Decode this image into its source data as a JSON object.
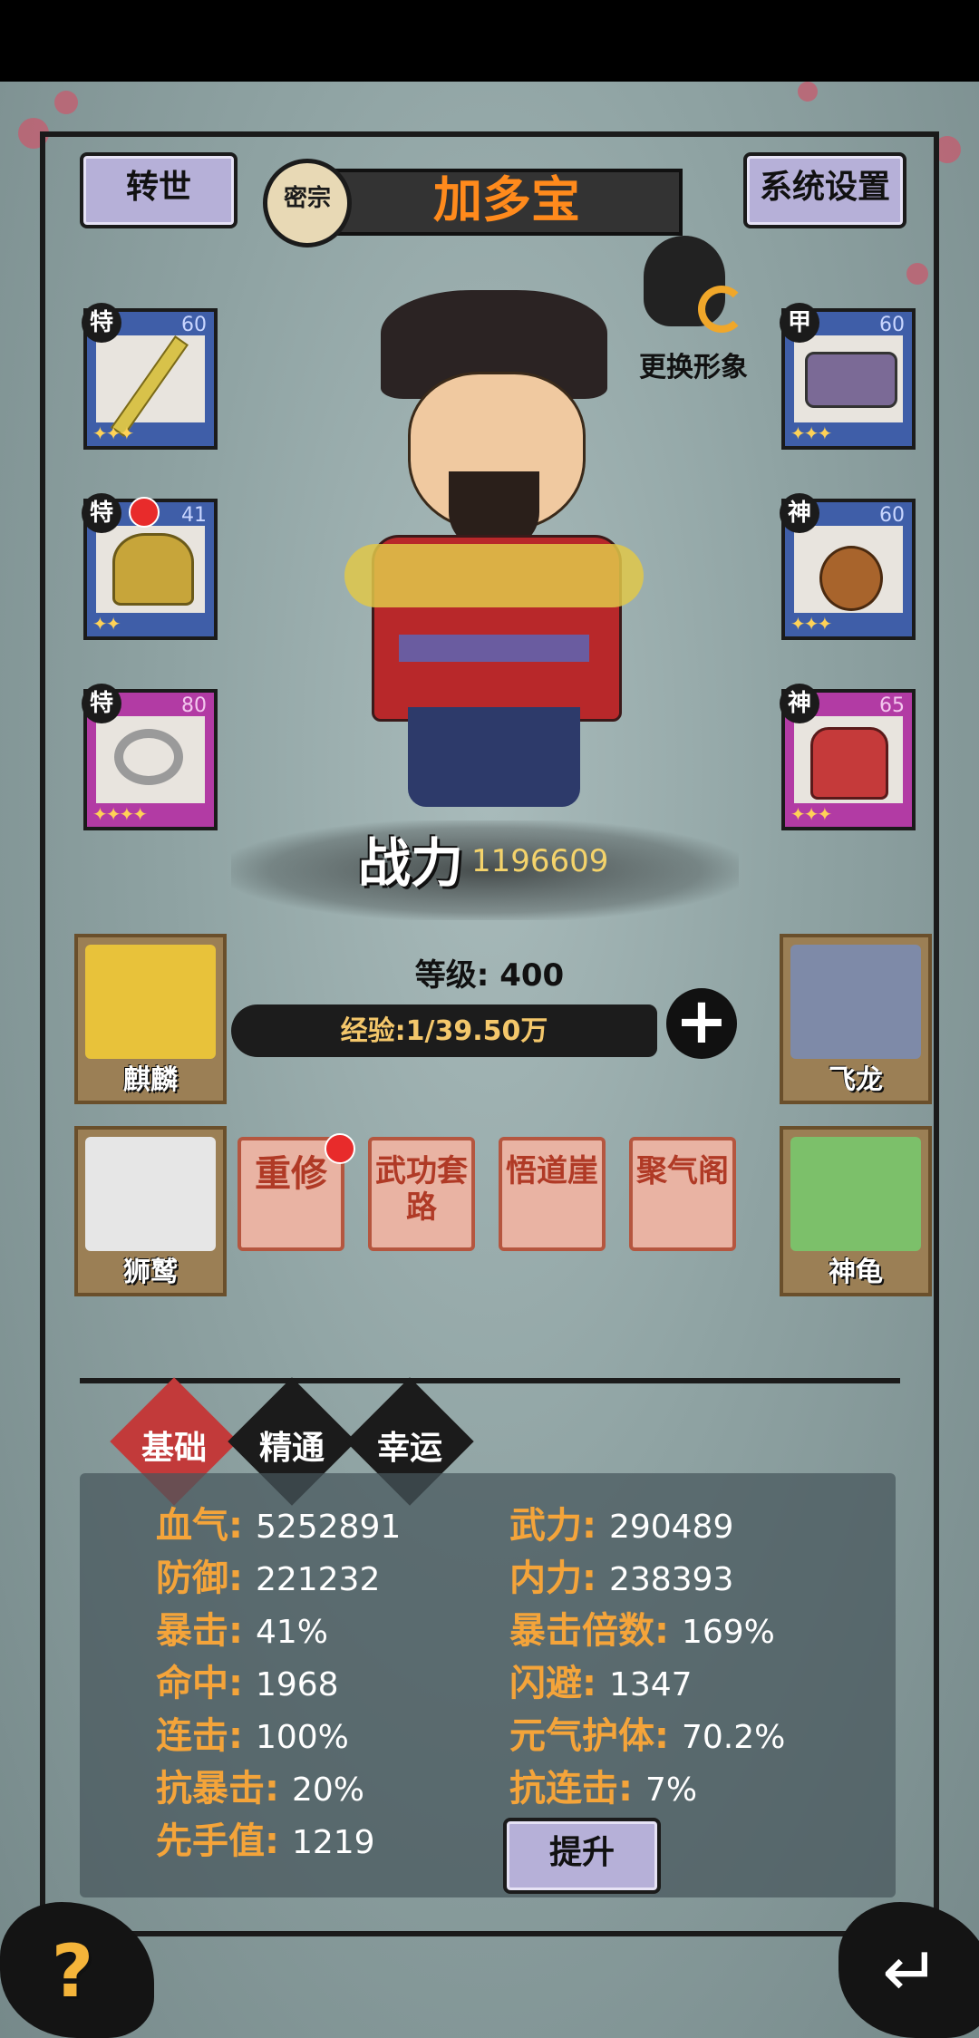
{
  "header": {
    "rebirth_label": "转世",
    "sect_badge": "密宗",
    "hero_name": "加多宝",
    "settings_label": "系统设置"
  },
  "change_look": {
    "label": "更换形象"
  },
  "equipment": {
    "left": [
      {
        "tag": "特",
        "level": "60",
        "stars": "✦✦✦",
        "item": "sword"
      },
      {
        "tag": "特",
        "level": "41",
        "stars": "✦✦",
        "item": "crown"
      },
      {
        "tag": "特",
        "level": "80",
        "stars": "✦✦✦✦",
        "item": "ring"
      }
    ],
    "right": [
      {
        "tag": "甲",
        "level": "60",
        "stars": "✦✦✦",
        "item": "armor"
      },
      {
        "tag": "神",
        "level": "60",
        "stars": "✦✦✦",
        "item": "gourd"
      },
      {
        "tag": "神",
        "level": "65",
        "stars": "✦✦✦",
        "item": "boots"
      }
    ]
  },
  "power": {
    "label": "战力",
    "value": "1196609"
  },
  "level": {
    "text": "等级: 400"
  },
  "exp": {
    "text": "经验:1/39.50万",
    "plus": "+"
  },
  "pets": {
    "qilin": "麒麟",
    "feilong": "飞龙",
    "shijiu": "狮鹫",
    "shengui": "神龟"
  },
  "functions": [
    "重修",
    "武功套路",
    "悟道崖",
    "聚气阁"
  ],
  "tabs": [
    "基础",
    "精通",
    "幸运"
  ],
  "stats_left": [
    {
      "k": "血气:",
      "v": "5252891"
    },
    {
      "k": "防御:",
      "v": "221232"
    },
    {
      "k": "暴击:",
      "v": "41%"
    },
    {
      "k": "命中:",
      "v": "1968"
    },
    {
      "k": "连击:",
      "v": "100%"
    },
    {
      "k": "抗暴击:",
      "v": "20%"
    },
    {
      "k": "先手值:",
      "v": "1219"
    }
  ],
  "stats_right": [
    {
      "k": "武力:",
      "v": "290489"
    },
    {
      "k": "内力:",
      "v": "238393"
    },
    {
      "k": "暴击倍数:",
      "v": "169%"
    },
    {
      "k": "闪避:",
      "v": "1347"
    },
    {
      "k": "元气护体:",
      "v": "70.2%"
    },
    {
      "k": "抗连击:",
      "v": "7%"
    }
  ],
  "upgrade_label": "提升",
  "help_label": "?",
  "back_label": "↵"
}
